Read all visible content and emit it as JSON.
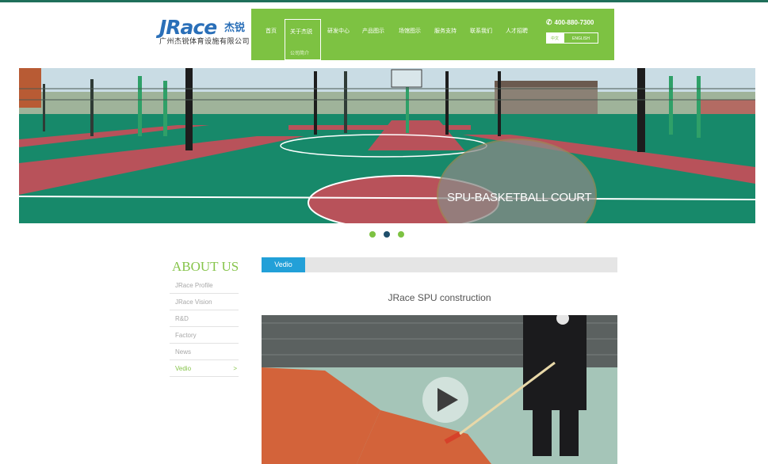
{
  "header": {
    "logo_mark": "JRace",
    "logo_cn": "杰锐",
    "company_name": "广州杰锐体育设施有限公司",
    "nav": [
      "首页",
      "关于杰锐",
      "研发中心",
      "产品图示",
      "场馆图示",
      "服务支持",
      "联系我们",
      "人才招聘"
    ],
    "active_nav": "关于杰锐",
    "active_sub": "公司简介",
    "phone": "400-880-7300",
    "lang": [
      "中文",
      "ENGLISH"
    ]
  },
  "hero": {
    "caption": "SPU-BASKETBALL COURT",
    "dots": 3,
    "active_dot": 1
  },
  "about": {
    "title": "ABOUT US",
    "items": [
      {
        "label": "JRace Profile",
        "active": false
      },
      {
        "label": "JRace Vision",
        "active": false
      },
      {
        "label": "R&D",
        "active": false
      },
      {
        "label": "Factory",
        "active": false
      },
      {
        "label": "News",
        "active": false
      },
      {
        "label": "Vedio",
        "active": true,
        "arrow": ">"
      }
    ],
    "tab": "Vedio",
    "video_title": "JRace SPU construction"
  },
  "colors": {
    "brand_green": "#7dc242",
    "logo_blue": "#2a6fb8",
    "tab_blue": "#22a0d8",
    "court_green": "#17896a",
    "court_red": "#b8525a"
  }
}
